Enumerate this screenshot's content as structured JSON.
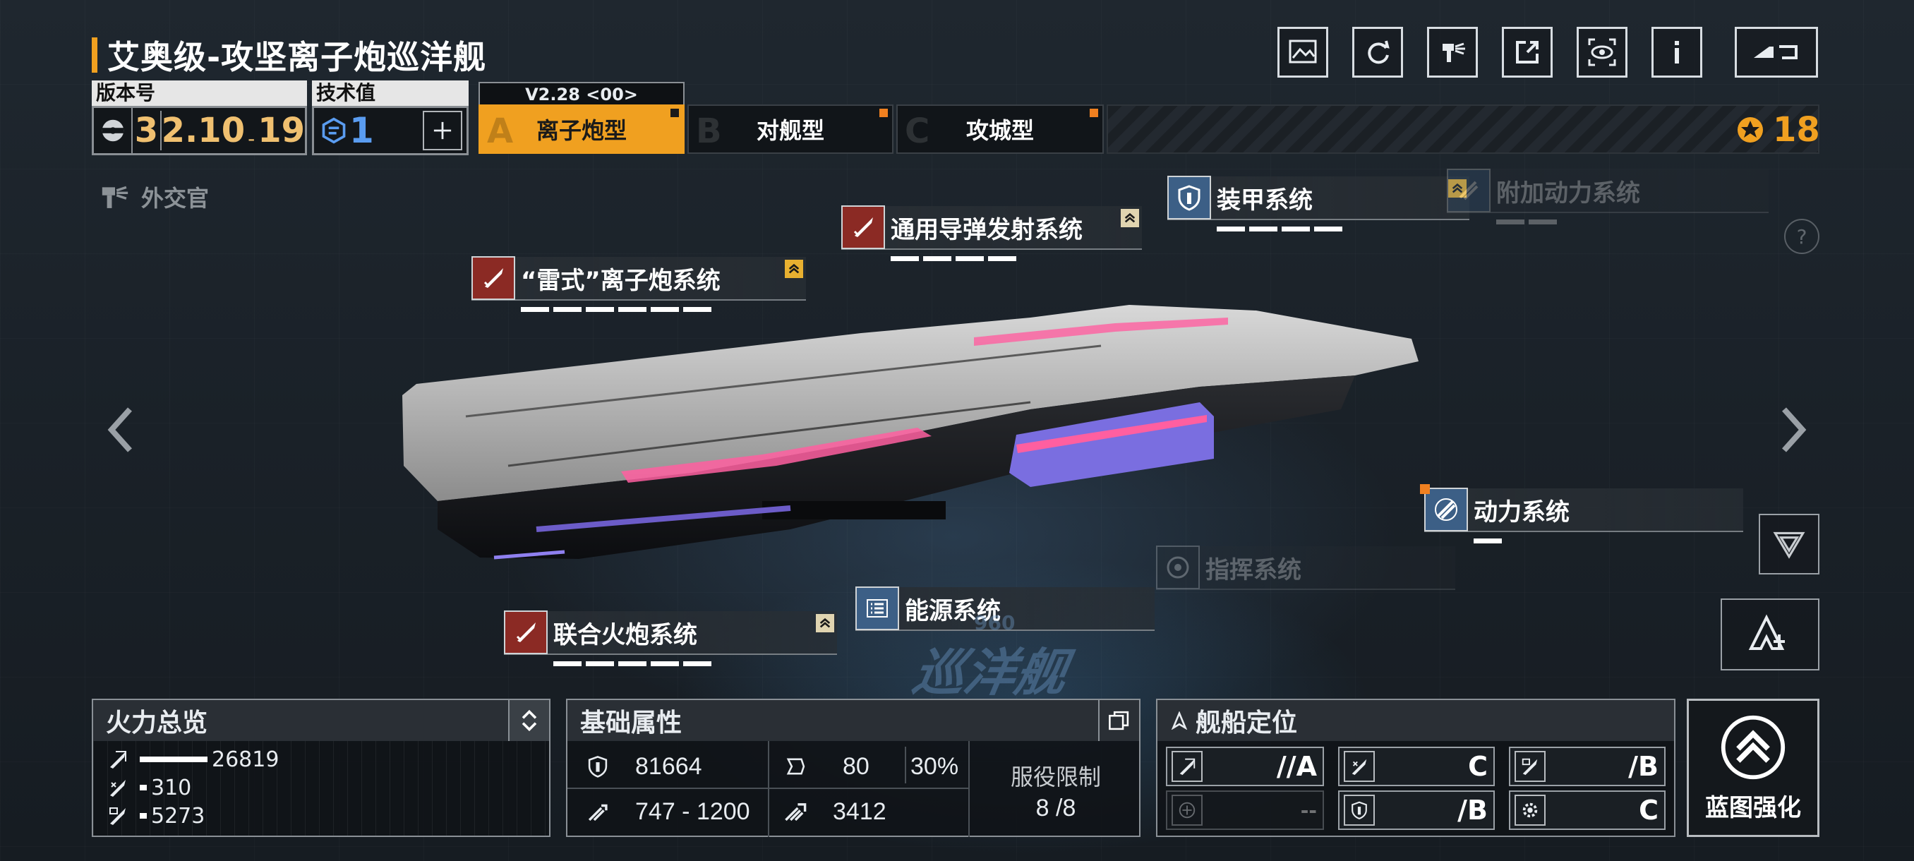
{
  "ship": {
    "title": "艾奥级-攻坚离子炮巡洋舰",
    "class_watermark": "巡洋舰",
    "watermark_number": "960"
  },
  "version": {
    "label": "版本号",
    "major": "3",
    "value": "2.10",
    "sep": "-",
    "minor": "19"
  },
  "tech": {
    "label": "技术值",
    "value": "1",
    "add_icon": "plus-icon"
  },
  "variant_version": "V2.28 <00>",
  "tabs": [
    {
      "letter": "A",
      "label": "离子炮型",
      "active": true
    },
    {
      "letter": "B",
      "label": "对舰型",
      "active": false
    },
    {
      "letter": "C",
      "label": "攻城型",
      "active": false
    }
  ],
  "currency": {
    "icon": "star-badge-icon",
    "value": "18"
  },
  "toolbar_icons": [
    "gallery-icon",
    "refresh-icon",
    "diplomat-icon",
    "share-icon",
    "view-icon",
    "info-icon",
    "back-icon"
  ],
  "diplomat": {
    "icon": "diplomat-icon",
    "label": "外交官"
  },
  "systems": {
    "ion_cannon": {
      "label": "“雷式”离子炮系统",
      "icon": "missile-icon",
      "icon_tag": "M",
      "pips": 6
    },
    "missile": {
      "label": "通用导弹发射系统",
      "icon": "missile-icon",
      "pips": 4
    },
    "armor": {
      "label": "装甲系统",
      "icon": "shield-icon",
      "pips": 4
    },
    "aux_power": {
      "label": "附加动力系统",
      "icon": "engine-icon",
      "pips": 2
    },
    "power": {
      "label": "动力系统",
      "icon": "engine-icon",
      "pips": 1
    },
    "command": {
      "label": "指挥系统",
      "icon": "target-icon",
      "pips": 0
    },
    "energy": {
      "label": "能源系统",
      "icon": "list-icon",
      "pips": 0
    },
    "combined_cannon": {
      "label": "联合火炮系统",
      "icon": "missile-icon",
      "pips": 5
    }
  },
  "firepower": {
    "title": "火力总览",
    "rows": [
      {
        "icon": "anti-ship-icon",
        "value": "26819",
        "fraction": 1.0
      },
      {
        "icon": "anti-air-icon",
        "value": "310",
        "fraction": 0.06
      },
      {
        "icon": "siege-icon",
        "value": "5273",
        "fraction": 0.06
      }
    ]
  },
  "base_stats": {
    "title": "基础属性",
    "hp": "81664",
    "armor": "80",
    "armor_pct": "30%",
    "speed": "747 - 1200",
    "warp": "3412",
    "service_limit_label": "服役限制",
    "service_limit": "8 /8"
  },
  "positioning": {
    "title": "舰船定位",
    "grades": [
      {
        "icon": "anti-ship-icon",
        "value": "//A",
        "dim": false
      },
      {
        "icon": "anti-air-icon",
        "value": "C",
        "dim": false
      },
      {
        "icon": "siege-icon",
        "value": "/B",
        "dim": false
      },
      {
        "icon": "support-icon",
        "value": "--",
        "dim": true
      },
      {
        "icon": "shield-icon",
        "value": "/B",
        "dim": false
      },
      {
        "icon": "gear-icon",
        "value": "C",
        "dim": false
      }
    ]
  },
  "blueprint": {
    "icon": "chevron-up-circle-icon",
    "label": "蓝图强化"
  },
  "colors": {
    "accent": "#f0a020",
    "weapon_icon_bg": "#8b2a24",
    "defense_icon_bg": "#3c5f86"
  }
}
